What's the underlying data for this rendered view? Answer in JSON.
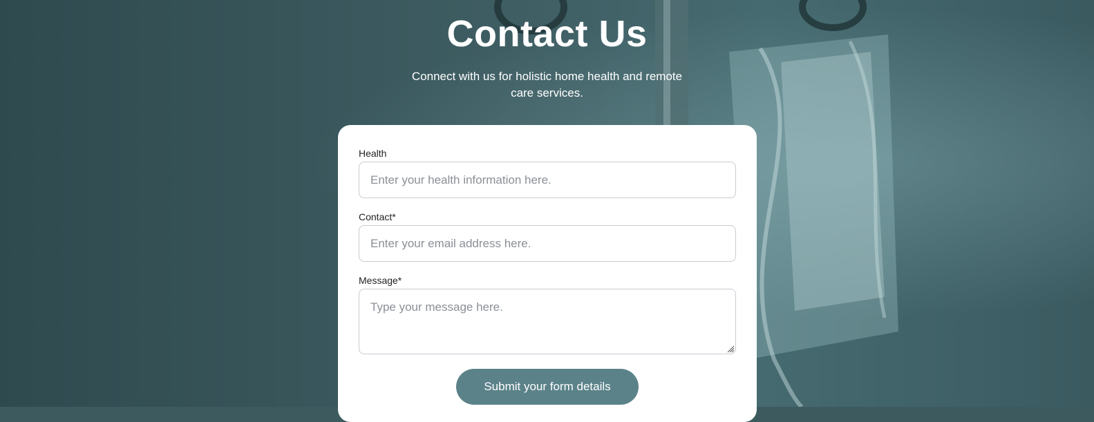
{
  "header": {
    "title": "Contact Us",
    "subtitle": "Connect with us for holistic home health and remote care services."
  },
  "form": {
    "health": {
      "label": "Health",
      "placeholder": "Enter your health information here."
    },
    "contact": {
      "label": "Contact*",
      "placeholder": "Enter your email address here."
    },
    "message": {
      "label": "Message*",
      "placeholder": "Type your message here."
    },
    "submit_label": "Submit your form details"
  },
  "colors": {
    "background": "#3d5a5f",
    "card": "#ffffff",
    "button": "#5b8289"
  },
  "icons": {
    "textarea_resize": "resize-grip-icon"
  }
}
